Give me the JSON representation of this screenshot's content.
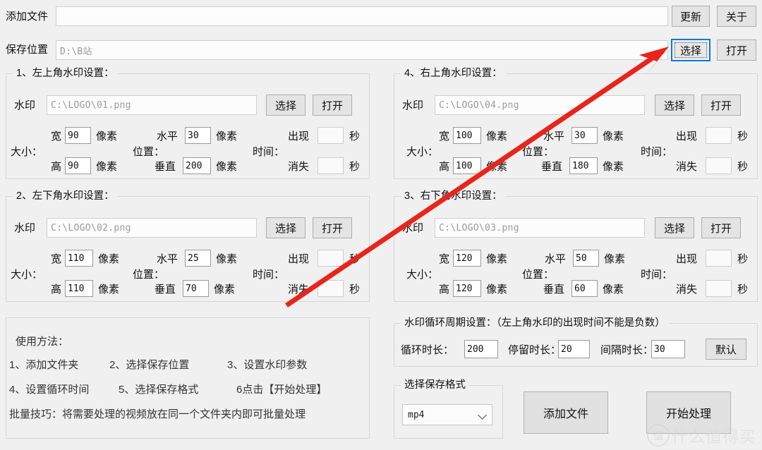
{
  "topbar": {
    "add_file_label": "添加文件",
    "add_file_value": "",
    "add_file_placeholder": "",
    "update_button": "更新",
    "about_button": "关于",
    "save_location_label": "保存位置",
    "save_location_value": "D:\\B站",
    "choose_button": "选择",
    "open_button": "打开"
  },
  "panels": [
    {
      "title": "1、左上角水印设置：",
      "watermark_label": "水印",
      "watermark_path": "C:\\LOGO\\01.png",
      "choose_button": "选择",
      "open_button": "打开",
      "size_label": "大小：",
      "width_label": "宽",
      "width_value": "90",
      "height_label": "高",
      "height_value": "90",
      "pixel_unit": "像素",
      "position_label": "位置：",
      "horizontal_label": "水平",
      "horizontal_value": "30",
      "vertical_label": "垂直",
      "vertical_value": "200",
      "time_label": "时间：",
      "appear_label": "出现",
      "appear_value": "",
      "disappear_label": "消失",
      "disappear_value": "",
      "second_unit": "秒"
    },
    {
      "title": "4、右上角水印设置：",
      "watermark_label": "水印",
      "watermark_path": "C:\\LOGO\\04.png",
      "choose_button": "选择",
      "open_button": "打开",
      "size_label": "大小：",
      "width_label": "宽",
      "width_value": "100",
      "height_label": "高",
      "height_value": "100",
      "pixel_unit": "像素",
      "position_label": "位置：",
      "horizontal_label": "水平",
      "horizontal_value": "30",
      "vertical_label": "垂直",
      "vertical_value": "180",
      "time_label": "时间：",
      "appear_label": "出现",
      "appear_value": "",
      "disappear_label": "消失",
      "disappear_value": "",
      "second_unit": "秒"
    },
    {
      "title": "2、左下角水印设置：",
      "watermark_label": "水印",
      "watermark_path": "C:\\LOGO\\02.png",
      "choose_button": "选择",
      "open_button": "打开",
      "size_label": "大小：",
      "width_label": "宽",
      "width_value": "110",
      "height_label": "高",
      "height_value": "110",
      "pixel_unit": "像素",
      "position_label": "位置：",
      "horizontal_label": "水平",
      "horizontal_value": "25",
      "vertical_label": "垂直",
      "vertical_value": "70",
      "time_label": "时间：",
      "appear_label": "出现",
      "appear_value": "",
      "disappear_label": "消失",
      "disappear_value": "",
      "second_unit": "秒"
    },
    {
      "title": "3、右下角水印设置：",
      "watermark_label": "水印",
      "watermark_path": "C:\\LOGO\\03.png",
      "choose_button": "选择",
      "open_button": "打开",
      "size_label": "大小：",
      "width_label": "宽",
      "width_value": "120",
      "height_label": "高",
      "height_value": "120",
      "pixel_unit": "像素",
      "position_label": "位置：",
      "horizontal_label": "水平",
      "horizontal_value": "50",
      "vertical_label": "垂直",
      "vertical_value": "60",
      "time_label": "时间：",
      "appear_label": "出现",
      "appear_value": "",
      "disappear_label": "消失",
      "disappear_value": "",
      "second_unit": "秒"
    }
  ],
  "help": {
    "title": "使用方法：",
    "line1_a": "1、添加文件夹",
    "line1_b": "2、选择保存位置",
    "line1_c": "3、设置水印参数",
    "line2_a": "4、设置循环时间",
    "line2_b": "5、选择保存格式",
    "line2_c": "6点击【开始处理】",
    "line3": "批量技巧：将需要处理的视频放在同一个文件夹内即可批量处理"
  },
  "cycle": {
    "title": "水印循环周期设置：（左上角水印的出现时间不能是负数）",
    "duration_label": "循环时长：",
    "duration_value": "200",
    "stay_label": "停留时长：",
    "stay_value": "20",
    "interval_label": "间隔时长：",
    "interval_value": "30",
    "default_button": "默认"
  },
  "format": {
    "title": "选择保存格式",
    "selected": "mp4"
  },
  "actions": {
    "add_file_button": "添加文件",
    "start_button": "开始处理"
  },
  "annotation": {
    "arrow_color": "#e8251b"
  },
  "watermark": {
    "badge": "值",
    "text": "什么值得买"
  }
}
